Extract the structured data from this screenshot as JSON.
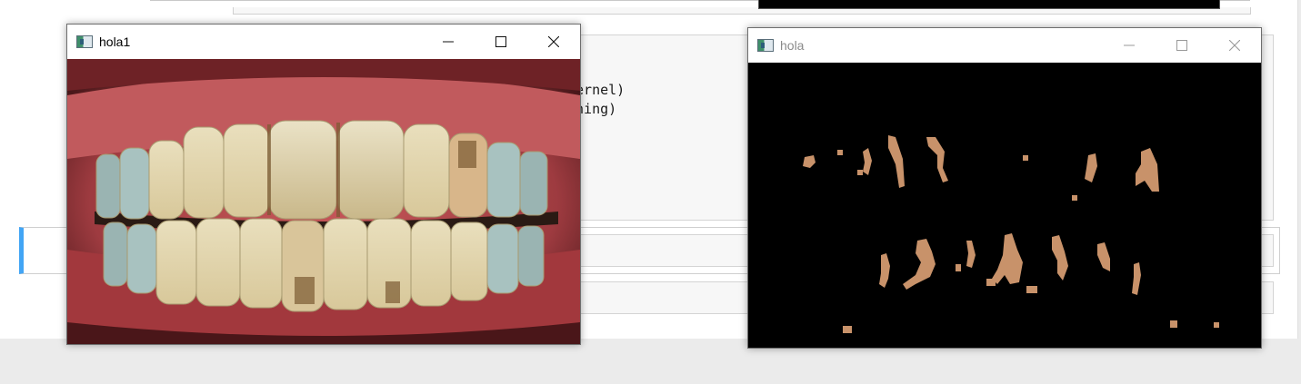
{
  "background": {
    "code_lines": [
      "kernel)",
      "ening)"
    ],
    "accent_color": "#42a5f5"
  },
  "windows": [
    {
      "title": "hola1",
      "state": "active",
      "content": "teeth-photo",
      "controls": [
        "minimize",
        "maximize",
        "close"
      ]
    },
    {
      "title": "hola",
      "state": "inactive",
      "content": "segmentation-mask",
      "controls": [
        "minimize",
        "maximize",
        "close"
      ]
    }
  ],
  "colors": {
    "mask_fg": "#c8926a",
    "mask_bg": "#000000",
    "gum": "#b84a4e",
    "tooth": "#e7dcb8"
  }
}
